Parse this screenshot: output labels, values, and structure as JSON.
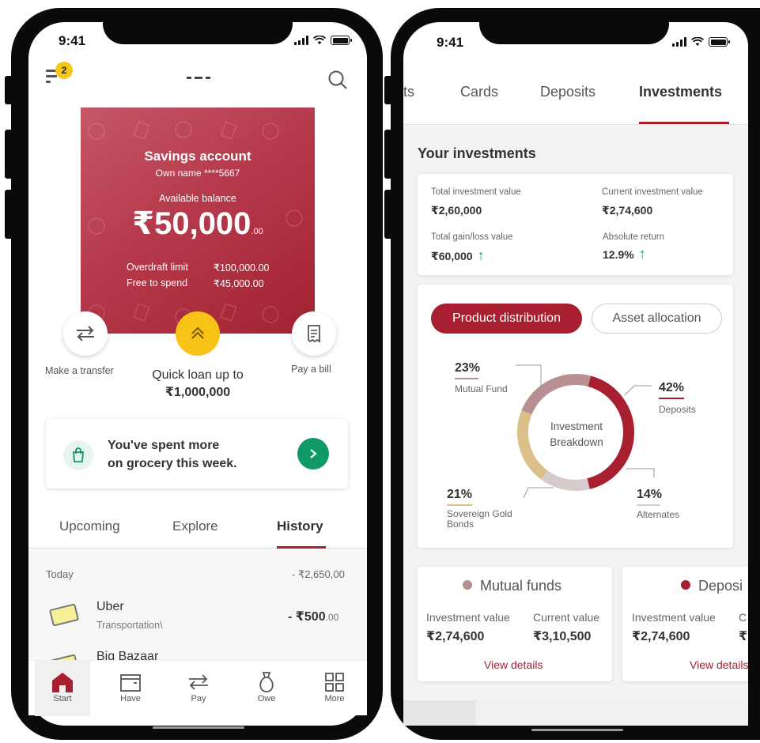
{
  "left_phone": {
    "status_time": "9:41",
    "menu_badge": "2",
    "account": {
      "title": "Savings account",
      "owner": "Own name ****5667",
      "balance_label": "Available balance",
      "balance_main": "₹50,000",
      "balance_decimals": ".00",
      "overdraft_label": "Overdraft limit",
      "overdraft_value": "₹100,000.00",
      "free_label": "Free to spend",
      "free_value": "₹45,000.00"
    },
    "actions": {
      "transfer_label": "Make a transfer",
      "loan_text": "Quick loan up to ",
      "loan_amount": "₹1,000,000",
      "bill_label": "Pay a bill"
    },
    "promo": {
      "line1": "You've spent more",
      "line2": "on grocery this week."
    },
    "tabs": [
      "Upcoming",
      "Explore",
      "History"
    ],
    "active_tab": "History",
    "history": {
      "day": "Today",
      "day_total": "- ₹2,650,00",
      "transactions": [
        {
          "name": "Uber",
          "category": "Transportation\\",
          "amount": "- ₹500",
          "decimals": ".00"
        },
        {
          "name": "Big Bazaar",
          "category": "",
          "amount": "",
          "decimals": ""
        }
      ]
    },
    "nav": [
      {
        "label": "Start",
        "icon": "home-icon"
      },
      {
        "label": "Have",
        "icon": "wallet-icon"
      },
      {
        "label": "Pay",
        "icon": "transfer-icon"
      },
      {
        "label": "Owe",
        "icon": "money-bag-icon"
      },
      {
        "label": "More",
        "icon": "grid-icon"
      }
    ]
  },
  "right_phone": {
    "status_time": "9:41",
    "tabs": [
      "ts",
      "Cards",
      "Deposits",
      "Investments"
    ],
    "active_tab": "Investments",
    "section_title": "Your investments",
    "summary": {
      "total_investment_label": "Total investment value",
      "total_investment_value": "₹2,60,000",
      "current_investment_label": "Current investment value",
      "current_investment_value": "₹2,74,600",
      "gain_label": "Total gain/loss value",
      "gain_value": "₹60,000",
      "return_label": "Absolute return",
      "return_value": "12.9%"
    },
    "distribution_tabs": [
      "Product distribution",
      "Asset allocation"
    ],
    "active_distribution_tab": "Product distribution",
    "donut_center": [
      "Investment",
      "Breakdown"
    ],
    "breakdown": [
      {
        "label": "Mutual Fund",
        "percent": "23%",
        "value": 23,
        "color": "#b89092"
      },
      {
        "label": "Deposits",
        "percent": "42%",
        "value": 42,
        "color": "#a8202f"
      },
      {
        "label": "Alternates",
        "percent": "14%",
        "value": 14,
        "color": "#d6cbcb"
      },
      {
        "label": "Sovereign Gold Bonds",
        "percent": "21%",
        "value": 21,
        "color": "#dcc08a"
      }
    ],
    "fund_cards": [
      {
        "title": "Mutual funds",
        "dot_color": "#b89092",
        "investment_label": "Investment value",
        "investment_value": "₹2,74,600",
        "current_label": "Current value",
        "current_value": "₹3,10,500",
        "link": "View details"
      },
      {
        "title": "Deposi",
        "dot_color": "#a8202f",
        "investment_label": "Investment value",
        "investment_value": "₹2,74,600",
        "current_label": "C",
        "current_value": "₹",
        "link": "View details"
      }
    ]
  },
  "colors": {
    "brand": "#a8202f",
    "success": "#0f9966",
    "accent_yellow": "#f6c316"
  }
}
